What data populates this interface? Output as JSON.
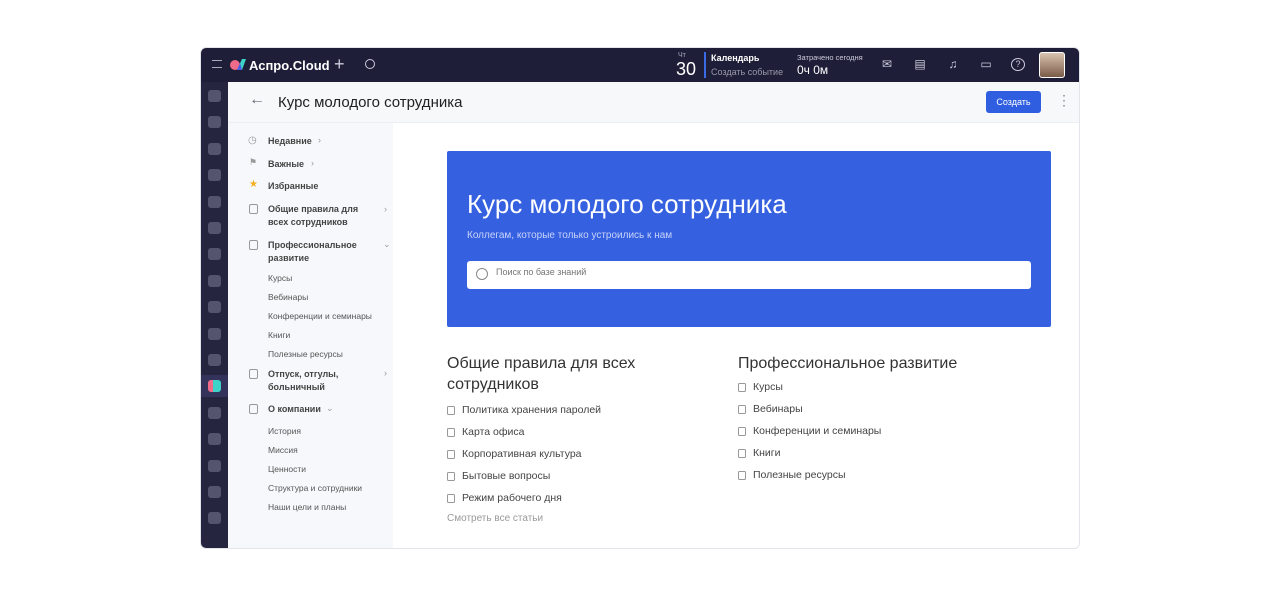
{
  "topbar": {
    "brand": "Аспро.Cloud",
    "day_of_week": "Чт",
    "day": "30",
    "calendar_title": "Календарь",
    "calendar_action": "Создать событие",
    "spent_label": "Затрачено сегодня",
    "spent_value": "0ч 0м",
    "icons": [
      "mail-icon",
      "notes-icon",
      "bell-icon",
      "chat-icon",
      "help-icon"
    ]
  },
  "rail": {
    "icons": [
      "tasks-icon",
      "projects-icon",
      "funnel-icon",
      "crm-icon",
      "team-icon",
      "finance-icon",
      "docs-icon",
      "files-icon",
      "users-icon",
      "export-icon",
      "services-icon",
      "knowledge-base-icon",
      "learning-icon",
      "time-icon",
      "education-icon",
      "support-icon",
      "profile-icon"
    ],
    "active_index": 11
  },
  "header": {
    "title": "Курс молодого сотрудника",
    "create_label": "Создать"
  },
  "nav": {
    "recent": "Недавние",
    "important": "Важные",
    "favorites": "Избранные",
    "general": "Общие правила для всех сотрудников",
    "professional": "Профессиональное развитие",
    "professional_items": [
      "Курсы",
      "Вебинары",
      "Конференции и семинары",
      "Книги",
      "Полезные ресурсы"
    ],
    "vacation": "Отпуск, отгулы, больничный",
    "company": "О компании",
    "company_items": [
      "История",
      "Миссия",
      "Ценности",
      "Структура и сотрудники",
      "Наши цели и планы"
    ]
  },
  "banner": {
    "title": "Курс молодого сотрудника",
    "subtitle": "Коллегам, которые только устроились к нам",
    "search_placeholder": "Поиск по базе знаний"
  },
  "sections": [
    {
      "title": "Общие правила для всех сотрудников",
      "items": [
        "Политика хранения паролей",
        "Карта офиса",
        "Корпоративная культура",
        "Бытовые вопросы",
        "Режим рабочего дня"
      ],
      "see_all": "Смотреть все статьи"
    },
    {
      "title": "Профессиональное развитие",
      "items": [
        "Курсы",
        "Вебинары",
        "Конференции и семинары",
        "Книги",
        "Полезные ресурсы"
      ]
    }
  ]
}
